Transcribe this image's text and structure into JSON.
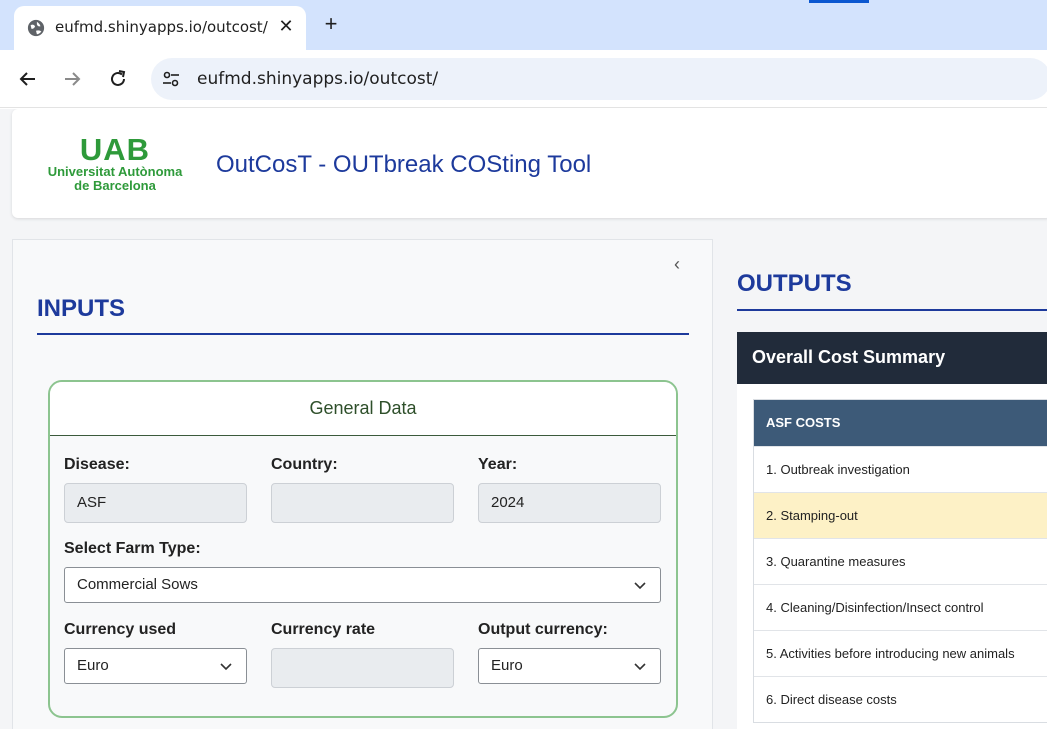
{
  "browser": {
    "tab_title": "eufmd.shinyapps.io/outcost/",
    "close_glyph": "✕",
    "newtab_glyph": "+",
    "url": "eufmd.shinyapps.io/outcost/",
    "icons": [
      "globe-icon",
      "close-icon",
      "plus-icon",
      "back-arrow-icon",
      "forward-arrow-icon",
      "reload-icon",
      "site-settings-icon"
    ]
  },
  "header": {
    "logo_big": "UAB",
    "logo_line1": "Universitat Autònoma",
    "logo_line2": "de Barcelona",
    "app_title": "OutCosT - OUTbreak COSting Tool"
  },
  "inputs": {
    "section_title": "INPUTS",
    "collapse_glyph": "‹",
    "general_data": {
      "title": "General Data",
      "disease_label": "Disease:",
      "disease_value": "ASF",
      "country_label": "Country:",
      "country_value": "",
      "year_label": "Year:",
      "year_value": "2024",
      "farm_type_label": "Select Farm Type:",
      "farm_type_value": "Commercial Sows",
      "currency_used_label": "Currency used",
      "currency_used_value": "Euro",
      "currency_rate_label": "Currency rate",
      "currency_rate_value": "",
      "output_currency_label": "Output currency:",
      "output_currency_value": "Euro"
    }
  },
  "outputs": {
    "section_title": "OUTPUTS",
    "summary_title": "Overall Cost Summary",
    "table_header": "ASF COSTS",
    "rows": [
      "1. Outbreak investigation",
      "2. Stamping-out",
      "3. Quarantine measures",
      "4. Cleaning/Disinfection/Insect control",
      "5. Activities before introducing new animals",
      "6. Direct disease costs"
    ],
    "highlighted_row_index": 1
  },
  "colors": {
    "brand_green": "#2e9a3a",
    "title_blue": "#1d3a9c",
    "card_border_green": "#8cc48f",
    "summary_header": "#212b3a",
    "table_header": "#3d5a78",
    "highlight_row": "#fdf1c6"
  }
}
